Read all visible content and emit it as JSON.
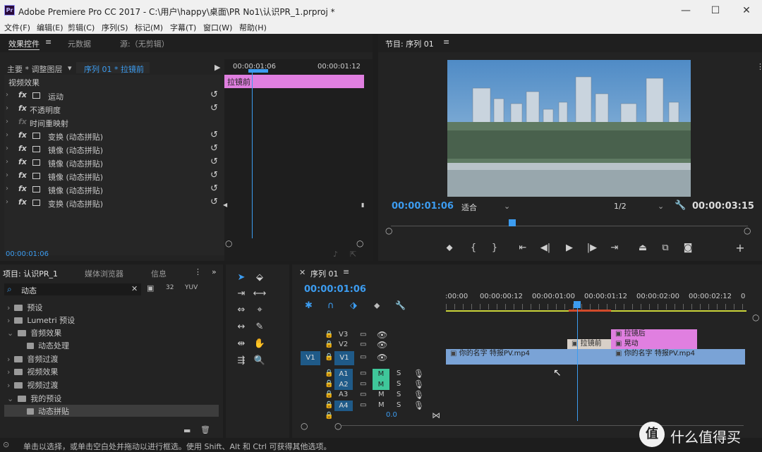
{
  "window": {
    "title": "Adobe Premiere Pro CC 2017 - C:\\用户\\happy\\桌面\\PR No1\\认识PR_1.prproj *",
    "app_icon": "Pr"
  },
  "menu": [
    "文件(F)",
    "编辑(E)",
    "剪辑(C)",
    "序列(S)",
    "标记(M)",
    "字幕(T)",
    "窗口(W)",
    "帮助(H)"
  ],
  "effect_controls": {
    "tabs": [
      "效果控件",
      "元数据",
      "源:（无剪辑）"
    ],
    "header_left": "主要 * 调整图层",
    "header_right": "序列 01 * 拉镜前",
    "time_a": "00:00:01:06",
    "time_b": "00:00:01:12",
    "clip_label": "拉镜前",
    "section": "视频效果",
    "effects": [
      "运动",
      "不透明度",
      "时间重映射",
      "变换 (动态拼贴)",
      "镜像 (动态拼贴)",
      "镜像 (动态拼贴)",
      "镜像 (动态拼贴)",
      "镜像 (动态拼贴)",
      "变换 (动态拼贴)"
    ],
    "timecode": "00:00:01:06"
  },
  "program": {
    "title": "节目: 序列 01",
    "timecode": "00:00:01:06",
    "fit": "适合",
    "resolution": "1/2",
    "duration": "00:00:03:15"
  },
  "project": {
    "tabs": [
      "项目: 认识PR_1",
      "媒体浏览器",
      "信息"
    ],
    "search_value": "动态",
    "items": [
      {
        "label": "预设",
        "indent": 0,
        "open": false
      },
      {
        "label": "Lumetri 预设",
        "indent": 0,
        "open": false
      },
      {
        "label": "音频效果",
        "indent": 0,
        "open": true
      },
      {
        "label": "动态处理",
        "indent": 1,
        "open": false
      },
      {
        "label": "音频过渡",
        "indent": 0,
        "open": false
      },
      {
        "label": "视频效果",
        "indent": 0,
        "open": false
      },
      {
        "label": "视频过渡",
        "indent": 0,
        "open": false
      },
      {
        "label": "我的预设",
        "indent": 0,
        "open": true
      },
      {
        "label": "动态拼贴",
        "indent": 1,
        "open": false
      }
    ]
  },
  "timeline": {
    "tab": "序列 01",
    "timecode": "00:00:01:06",
    "ruler": [
      ":00:00",
      "00:00:00:12",
      "00:00:01:00",
      "00:00:01:12",
      "00:00:02:00",
      "00:00:02:12",
      "0"
    ],
    "tracks": [
      {
        "name": "V3",
        "type": "video"
      },
      {
        "name": "V2",
        "type": "video"
      },
      {
        "name": "V1",
        "type": "video",
        "source": "V1"
      },
      {
        "name": "A1",
        "type": "audio",
        "m": "M",
        "s": "S"
      },
      {
        "name": "A2",
        "type": "audio",
        "m": "M",
        "s": "S"
      },
      {
        "name": "A3",
        "type": "audio",
        "m": "M",
        "s": "S"
      },
      {
        "name": "A4",
        "type": "audio",
        "m": "M",
        "s": "S"
      }
    ],
    "master_value": "0.0",
    "clips": {
      "v3": "拉镜后",
      "v2a": "拉镜前",
      "v2b": "晃动",
      "v1a": "你的名字 特报PV.mp4",
      "v1b": "你的名字 特报PV.mp4"
    }
  },
  "status_bar": "单击以选择，或单击空白处并拖动以进行框选。使用 Shift、Alt 和 Ctrl 可获得其他选项。",
  "watermark": "什么值得买",
  "colors": {
    "accent": "#3c9cf0",
    "pink": "#e07fe0",
    "teal": "#3fc79a",
    "clip_blue": "#7aa3d6"
  }
}
